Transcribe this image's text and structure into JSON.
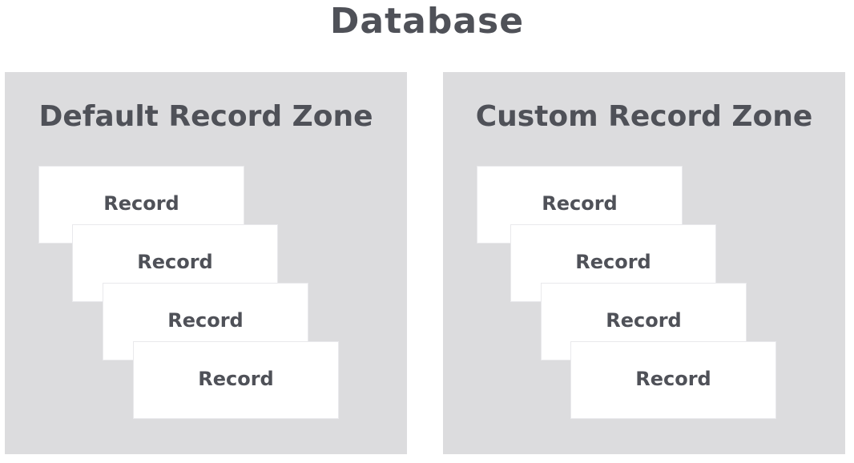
{
  "title": "Database",
  "zones": [
    {
      "title": "Default Record Zone",
      "records": [
        "Record",
        "Record",
        "Record",
        "Record"
      ]
    },
    {
      "title": "Custom Record Zone",
      "records": [
        "Record",
        "Record",
        "Record",
        "Record"
      ]
    }
  ],
  "colors": {
    "text": "#4f5158",
    "zone_background": "#dcdcde",
    "record_background": "#ffffff",
    "page_background": "#ffffff"
  }
}
